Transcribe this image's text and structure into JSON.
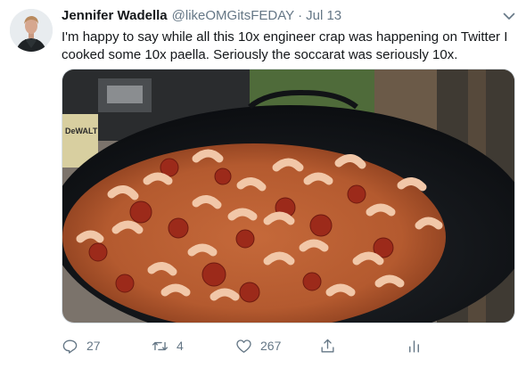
{
  "tweet": {
    "author_name": "Jennifer Wadella",
    "handle": "@likeOMGitsFEDAY",
    "separator": "·",
    "date": "Jul 13",
    "text": "I'm happy to say while all this 10x engineer crap was happening on Twitter I cooked some 10x paella. Seriously the soccarat was seriously 10x.",
    "media_brand_text": "DeWALT",
    "actions": {
      "reply_count": "27",
      "retweet_count": "4",
      "like_count": "267"
    }
  },
  "icons": {
    "avatar": "avatar-photo",
    "caret": "chevron-down-icon",
    "reply": "reply-icon",
    "retweet": "retweet-icon",
    "like": "heart-icon",
    "share": "share-icon",
    "analytics": "analytics-icon"
  },
  "colors": {
    "name": "#14171a",
    "secondary": "#657786",
    "border": "#d8e0e6"
  }
}
